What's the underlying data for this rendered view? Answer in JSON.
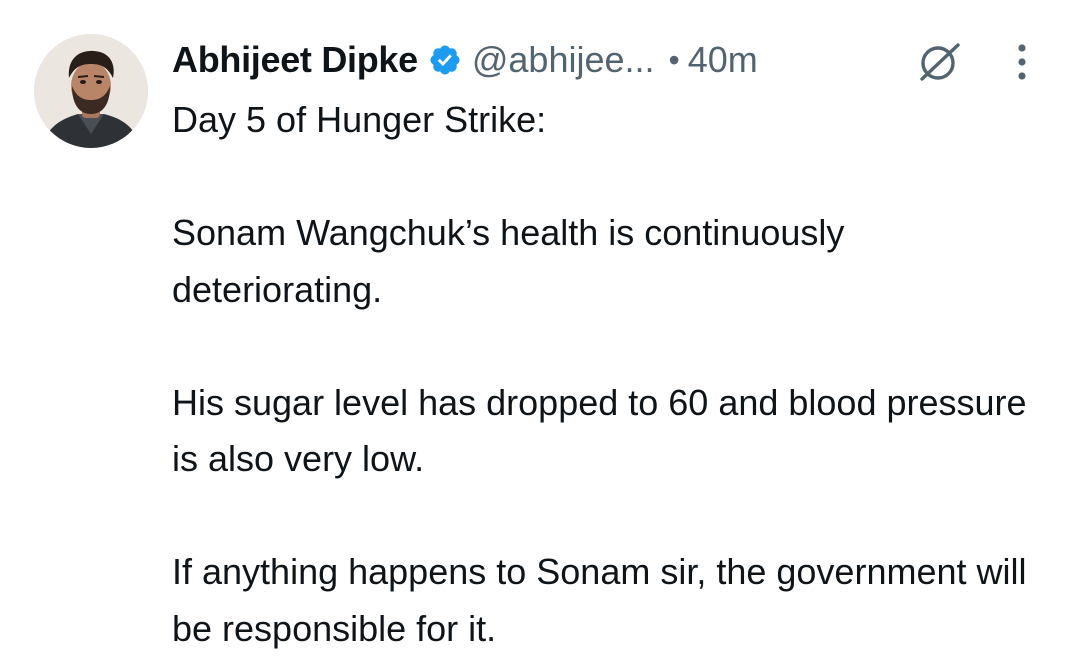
{
  "tweet": {
    "author": {
      "display_name": "Abhijeet Dipke",
      "verified": true,
      "handle": "@abhijee...",
      "avatar": "avatar-photo"
    },
    "separator": "•",
    "time": "40m",
    "icons": {
      "grok": "grok-icon",
      "more": "more-icon"
    },
    "lines": [
      "Day 5 of Hunger Strike:",
      "Sonam Wangchuk’s health is continuously deteriorating.",
      "His sugar level has dropped to 60 and blood pressure is also very low.",
      "If anything happens to Sonam sir, the government will be responsible for it."
    ],
    "colors": {
      "text": "#0f1419",
      "secondary": "#536471",
      "verified_badge": "#1d9bf0"
    }
  }
}
